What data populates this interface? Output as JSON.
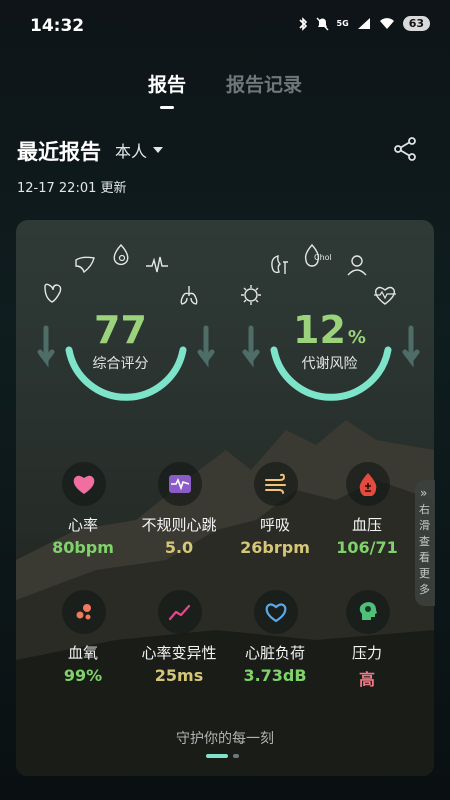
{
  "status": {
    "time": "14:32",
    "signal_label": "5G",
    "battery": "63"
  },
  "tabs": [
    {
      "label": "报告",
      "active": true
    },
    {
      "label": "报告记录",
      "active": false
    }
  ],
  "recent": {
    "title": "最近报告",
    "person": "本人",
    "updated": "12-17 22:01 更新"
  },
  "gauges": {
    "score": {
      "value": "77",
      "label": "综合评分"
    },
    "risk": {
      "value": "12",
      "unit": "%",
      "label": "代谢风险"
    }
  },
  "organ_icons": {
    "left": [
      "liver-icon",
      "blood-drop-icon",
      "ecg-wave-icon",
      "stomach-icon",
      "lungs-icon"
    ],
    "right": [
      "kidney-icon",
      "cholesterol-icon",
      "person-icon",
      "virus-icon",
      "heart-pulse-icon"
    ],
    "chol_text": "Chol"
  },
  "metrics": [
    {
      "label": "心率",
      "value": "80bpm",
      "color": "#7fd36a",
      "icon": "heart-icon"
    },
    {
      "label": "不规则心跳",
      "value": "5.0",
      "color": "#d6c776",
      "icon": "irregular-heartbeat-icon"
    },
    {
      "label": "呼吸",
      "value": "26brpm",
      "color": "#d6c776",
      "icon": "wind-icon"
    },
    {
      "label": "血压",
      "value": "106/71",
      "color": "#7fd36a",
      "icon": "blood-pressure-drop-icon"
    },
    {
      "label": "血氧",
      "value": "99%",
      "color": "#7fd36a",
      "icon": "oxygen-bubbles-icon"
    },
    {
      "label": "心率变异性",
      "value": "25ms",
      "color": "#d6c776",
      "icon": "trend-line-icon"
    },
    {
      "label": "心脏负荷",
      "value": "3.73dB",
      "color": "#7fd36a",
      "icon": "heart-outline-icon"
    },
    {
      "label": "压力",
      "value": "高",
      "color": "#ee7a86",
      "icon": "stress-head-icon"
    }
  ],
  "side_handle": {
    "text": "右滑查看更多"
  },
  "slogan": "守护你的每一刻",
  "colors": {
    "accent": "#7ee4c9",
    "good": "#7fd36a",
    "warn": "#d6c776",
    "bad": "#ee7a86"
  }
}
